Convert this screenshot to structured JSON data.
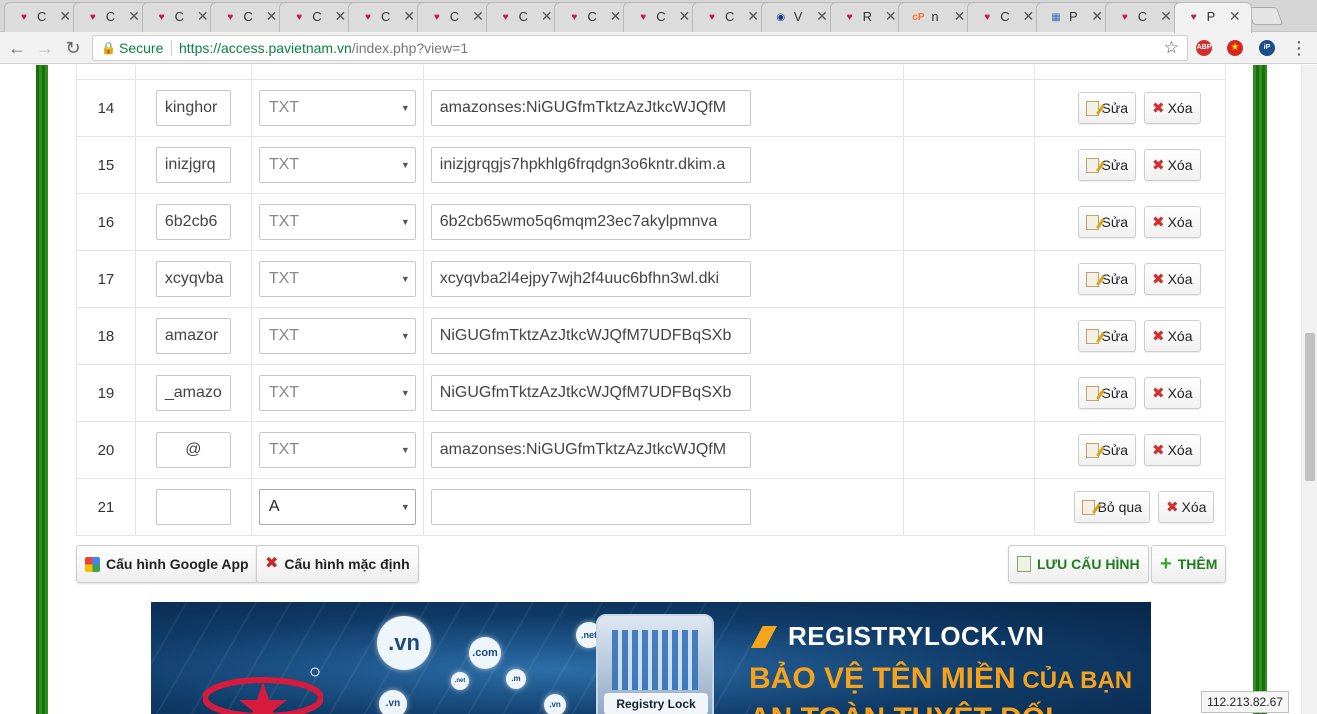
{
  "browser": {
    "tabs": [
      {
        "title": "C",
        "favicon": "pa-logo-icon"
      },
      {
        "title": "C",
        "favicon": "pa-logo-icon"
      },
      {
        "title": "C",
        "favicon": "pa-logo-icon"
      },
      {
        "title": "C",
        "favicon": "pa-logo-icon"
      },
      {
        "title": "C",
        "favicon": "pa-logo-icon"
      },
      {
        "title": "C",
        "favicon": "pa-logo-icon"
      },
      {
        "title": "C",
        "favicon": "pa-logo-icon"
      },
      {
        "title": "C",
        "favicon": "pa-logo-icon"
      },
      {
        "title": "C",
        "favicon": "pa-logo-icon"
      },
      {
        "title": "C",
        "favicon": "pa-logo-icon"
      },
      {
        "title": "C",
        "favicon": "pa-logo-icon"
      },
      {
        "title": "V",
        "favicon": "globe-icon"
      },
      {
        "title": "R",
        "favicon": "pa-logo-icon"
      },
      {
        "title": "n",
        "favicon": "cpanel-icon"
      },
      {
        "title": "C",
        "favicon": "pa-logo-icon"
      },
      {
        "title": "P",
        "favicon": "calendar-icon"
      },
      {
        "title": "C",
        "favicon": "pa-logo-icon"
      },
      {
        "title": "P",
        "favicon": "pa-logo-icon",
        "active": true
      }
    ],
    "secure_label": "Secure",
    "url_host": "https://access.pavietnam.vn",
    "url_path": "/index.php?view=1",
    "extensions": [
      "ABP",
      "VN",
      "iP"
    ]
  },
  "dns_records": [
    {
      "num": "14",
      "host": "kinghor",
      "type": "TXT",
      "value": "amazonses:NiGUGfmTktzAzJtkcWJQfM"
    },
    {
      "num": "15",
      "host": "inizjgrq",
      "type": "TXT",
      "value": "inizjgrqgjs7hpkhlg6frqdgn3o6kntr.dkim.a"
    },
    {
      "num": "16",
      "host": "6b2cb6",
      "type": "TXT",
      "value": "6b2cb65wmo5q6mqm23ec7akylpmnva"
    },
    {
      "num": "17",
      "host": "xcyqvba",
      "type": "TXT",
      "value": "xcyqvba2l4ejpy7wjh2f4uuc6bfhn3wl.dki"
    },
    {
      "num": "18",
      "host": "amazor",
      "type": "TXT",
      "value": "NiGUGfmTktzAzJtkcWJQfM7UDFBqSXb"
    },
    {
      "num": "19",
      "host": "_amazo",
      "type": "TXT",
      "value": "NiGUGfmTktzAzJtkcWJQfM7UDFBqSXb"
    },
    {
      "num": "20",
      "host": "@",
      "type": "TXT",
      "value": "amazonses:NiGUGfmTktzAzJtkcWJQfM"
    }
  ],
  "new_record": {
    "num": "21",
    "host": "",
    "type": "A",
    "value": ""
  },
  "labels": {
    "edit": "Sửa",
    "delete": "Xóa",
    "skip": "Bỏ qua",
    "google_app": "Cấu hình Google App",
    "default_config": "Cấu hình mặc định",
    "save_config": "LƯU CẤU HÌNH",
    "add": "THÊM"
  },
  "banner": {
    "title": "REGISTRYLOCK.VN",
    "subtitle_main": "BẢO VỆ TÊN MIỀN",
    "subtitle_small": " CỦA BẠN",
    "subtitle2": "AN TOÀN TUYỆT ĐỐI",
    "server_label": "Registry Lock",
    "globe_labels": [
      ".vn",
      ".com",
      ".net",
      ".vn",
      ".m",
      ".net",
      ".vn"
    ]
  },
  "ip_address": "112.213.82.67"
}
